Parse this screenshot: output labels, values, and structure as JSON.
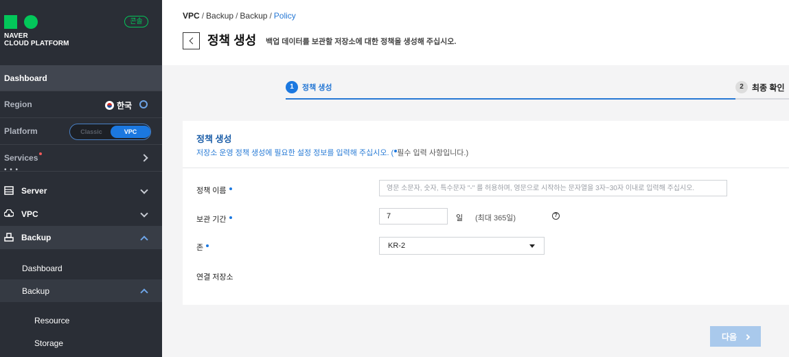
{
  "brand": {
    "line1": "NAVER",
    "line2": "CLOUD PLATFORM",
    "console_label": "콘솔",
    "color": "#03c75a"
  },
  "sidebar": {
    "dashboard_label": "Dashboard",
    "region": {
      "label": "Region",
      "value": "한국",
      "flag_icon": "korea-flag-icon",
      "settings_icon": "gear-icon"
    },
    "platform": {
      "label": "Platform",
      "options": [
        "Classic",
        "VPC"
      ],
      "selected": "VPC"
    },
    "services_label": "Services",
    "more_label": "• • •",
    "menu": [
      {
        "label": "Server",
        "icon": "server-icon",
        "expanded": false
      },
      {
        "label": "VPC",
        "icon": "vpc-cloud-icon",
        "expanded": false
      },
      {
        "label": "Backup",
        "icon": "backup-icon",
        "expanded": true
      }
    ],
    "submenu": [
      {
        "label": "Dashboard"
      },
      {
        "label": "Backup",
        "expanded": true
      }
    ],
    "subsubmenu": [
      {
        "label": "Resource"
      },
      {
        "label": "Storage"
      }
    ]
  },
  "header": {
    "breadcrumb": [
      "VPC",
      "Backup",
      "Backup",
      "Policy"
    ],
    "separator": "/",
    "title": "정책 생성",
    "description": "백업 데이터를 보관할 저장소에 대한 정책을 생성해 주십시오."
  },
  "steps": [
    {
      "num": "1",
      "label": "정책 생성",
      "active": true
    },
    {
      "num": "2",
      "label": "최종 확인",
      "active": false
    }
  ],
  "form": {
    "title": "정책 생성",
    "description": "저장소 운영 정책 생성에 필요한 설정 정보를 입력해 주십시오. (",
    "required_note": "필수 입력 사항입니다.)",
    "fields": {
      "name": {
        "label": "정책 이름",
        "value": "",
        "placeholder": "영문 소문자, 숫자, 특수문자 \"-\" 를 허용하며, 영문으로 시작하는 문자열을 3자~30자 이내로 입력해 주십시오."
      },
      "period": {
        "label": "보관 기간",
        "value": "7",
        "unit": "일",
        "hint": "(최대 365일)",
        "help": "?"
      },
      "zone": {
        "label": "존",
        "selected": "KR-2"
      },
      "storage": {
        "label": "연결 저장소"
      }
    }
  },
  "next_button": {
    "label": "다음"
  },
  "colors": {
    "accent": "#1b78e0",
    "sidebar_bg": "#2a2e36",
    "page_bg": "#f4f4f5"
  }
}
